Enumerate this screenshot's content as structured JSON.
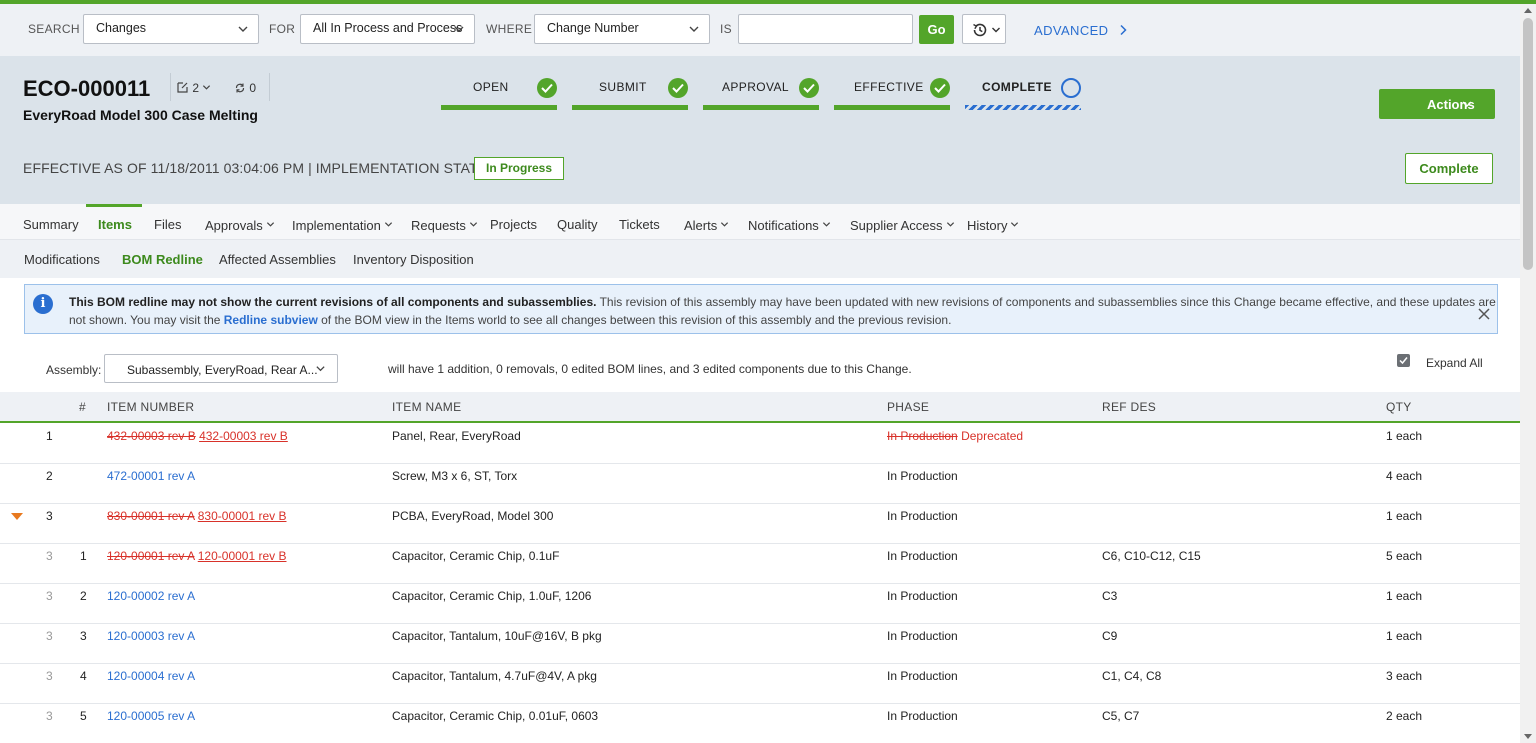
{
  "search": {
    "search_label": "SEARCH",
    "search_value": "Changes",
    "for_label": "FOR",
    "for_value": "All In Process and Process",
    "where_label": "WHERE",
    "where_value": "Change Number",
    "is_label": "IS",
    "is_value": "",
    "go_label": "Go",
    "advanced_label": "ADVANCED"
  },
  "header": {
    "number": "ECO-000011",
    "title": "EveryRoad Model 300 Case Melting",
    "attachments_count": "2",
    "relationships_count": "0",
    "workflow": [
      {
        "label": "OPEN",
        "state": "done"
      },
      {
        "label": "SUBMIT",
        "state": "done"
      },
      {
        "label": "APPROVAL",
        "state": "done"
      },
      {
        "label": "EFFECTIVE",
        "state": "done"
      },
      {
        "label": "COMPLETE",
        "state": "current"
      }
    ],
    "actions_label": "Actions",
    "effective_text": "EFFECTIVE AS OF 11/18/2011 03:04:06 PM | IMPLEMENTATION STATUS:",
    "implementation_status": "In Progress",
    "complete_label": "Complete"
  },
  "tabs": [
    {
      "label": "Summary"
    },
    {
      "label": "Items",
      "active": true
    },
    {
      "label": "Files"
    },
    {
      "label": "Approvals",
      "dropdown": true
    },
    {
      "label": "Implementation",
      "dropdown": true
    },
    {
      "label": "Requests",
      "dropdown": true
    },
    {
      "label": "Projects"
    },
    {
      "label": "Quality"
    },
    {
      "label": "Tickets"
    },
    {
      "label": "Alerts",
      "dropdown": true
    },
    {
      "label": "Notifications",
      "dropdown": true
    },
    {
      "label": "Supplier Access",
      "dropdown": true
    },
    {
      "label": "History",
      "dropdown": true
    }
  ],
  "subtabs": [
    {
      "label": "Modifications"
    },
    {
      "label": "BOM Redline",
      "active": true
    },
    {
      "label": "Affected Assemblies"
    },
    {
      "label": "Inventory Disposition"
    }
  ],
  "info": {
    "bold": "This BOM redline may not show the current revisions of all components and subassemblies.",
    "text1": " This revision of this assembly may have been updated with new revisions of components and subassemblies since this Change became effective, and these updates are not shown. You may visit the ",
    "link": "Redline subview",
    "text2": " of the BOM view in the Items world to see all changes between this revision of this assembly and the previous revision."
  },
  "assembly": {
    "label": "Assembly:",
    "value": "Subassembly, EveryRoad, Rear A...",
    "summary": "will have 1 addition, 0 removals, 0 edited BOM lines, and 3 edited components due to this Change.",
    "expand_all_label": "Expand All",
    "expand_all_checked": true
  },
  "table": {
    "headers": [
      "#",
      "ITEM NUMBER",
      "ITEM NAME",
      "PHASE",
      "REF DES",
      "QTY"
    ],
    "rows": [
      {
        "parent": "",
        "num": "1",
        "old_item": "432-00003 rev B",
        "item": "432-00003 rev B",
        "name": "Panel, Rear, EveryRoad",
        "old_phase": "In Production",
        "phase": "Deprecated",
        "refdes": "",
        "qty": "1 each",
        "expander": false
      },
      {
        "parent": "",
        "num": "2",
        "old_item": "",
        "item": "472-00001 rev A",
        "name": "Screw, M3 x 6, ST, Torx",
        "old_phase": "",
        "phase": "In Production",
        "refdes": "",
        "qty": "4 each",
        "expander": false
      },
      {
        "parent": "",
        "num": "3",
        "old_item": "830-00001 rev A",
        "item": "830-00001 rev B",
        "name": "PCBA, EveryRoad, Model 300",
        "old_phase": "",
        "phase": "In Production",
        "refdes": "",
        "qty": "1 each",
        "expander": true
      },
      {
        "parent": "3",
        "num": "1",
        "old_item": "120-00001 rev A",
        "item": "120-00001 rev B",
        "name": "Capacitor, Ceramic Chip, 0.1uF",
        "old_phase": "",
        "phase": "In Production",
        "refdes": "C6, C10-C12, C15",
        "qty": "5 each",
        "expander": false
      },
      {
        "parent": "3",
        "num": "2",
        "old_item": "",
        "item": "120-00002 rev A",
        "name": "Capacitor, Ceramic Chip, 1.0uF, 1206",
        "old_phase": "",
        "phase": "In Production",
        "refdes": "C3",
        "qty": "1 each",
        "expander": false
      },
      {
        "parent": "3",
        "num": "3",
        "old_item": "",
        "item": "120-00003 rev A",
        "name": "Capacitor, Tantalum, 10uF@16V, B pkg",
        "old_phase": "",
        "phase": "In Production",
        "refdes": "C9",
        "qty": "1 each",
        "expander": false
      },
      {
        "parent": "3",
        "num": "4",
        "old_item": "",
        "item": "120-00004 rev A",
        "name": "Capacitor, Tantalum, 4.7uF@4V, A pkg",
        "old_phase": "",
        "phase": "In Production",
        "refdes": "C1, C4, C8",
        "qty": "3 each",
        "expander": false
      },
      {
        "parent": "3",
        "num": "5",
        "old_item": "",
        "item": "120-00005 rev A",
        "name": "Capacitor, Ceramic Chip, 0.01uF, 0603",
        "old_phase": "",
        "phase": "In Production",
        "refdes": "C5, C7",
        "qty": "2 each",
        "expander": false
      }
    ]
  },
  "colors": {
    "accent_green": "#53a52a",
    "link_blue": "#2a6ed0",
    "redline_red": "#d8322a",
    "expander_orange": "#e8791f"
  }
}
